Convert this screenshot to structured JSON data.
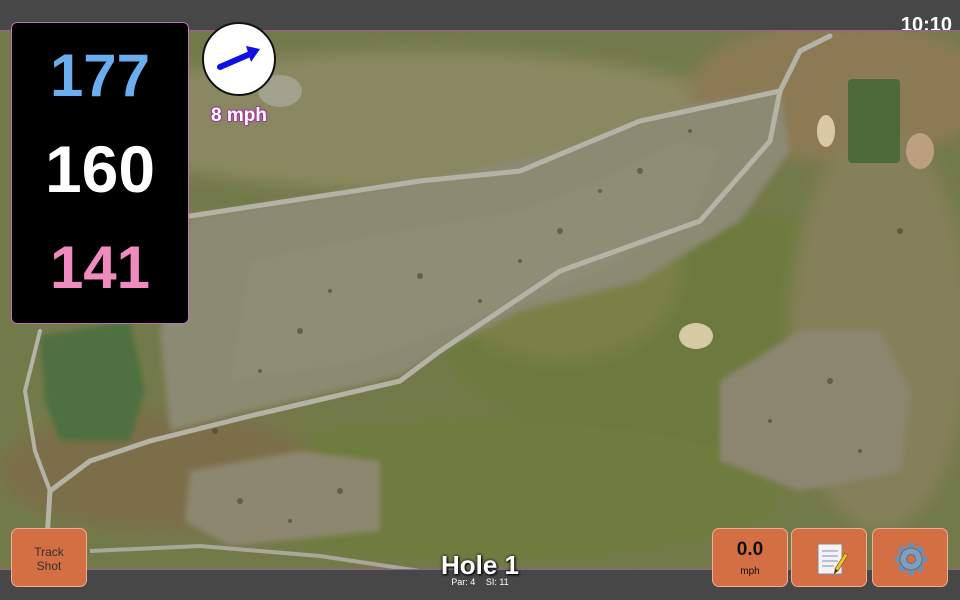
{
  "status_bar": {
    "time": "10:10"
  },
  "yardages": {
    "back": "177",
    "center": "160",
    "front": "141"
  },
  "wind": {
    "speed_label": "8 mph",
    "direction_icon": "arrow-icon"
  },
  "buttons": {
    "track_shot_line1": "Track",
    "track_shot_line2": "Shot",
    "speed_value": "0.0",
    "speed_unit": "mph",
    "notes_icon": "notepad-icon",
    "settings_icon": "gear-icon"
  },
  "hole": {
    "title": "Hole 1",
    "par": "Par: 4",
    "si": "SI: 11"
  },
  "colors": {
    "back_yardage": "#6aaef0",
    "center_yardage": "#ffffff",
    "front_yardage": "#f08bbf",
    "button": "#d36f42",
    "accent_border": "#c070c0",
    "wind_arrow": "#1010e0"
  },
  "map": {
    "view": "satellite-golf-hole"
  }
}
